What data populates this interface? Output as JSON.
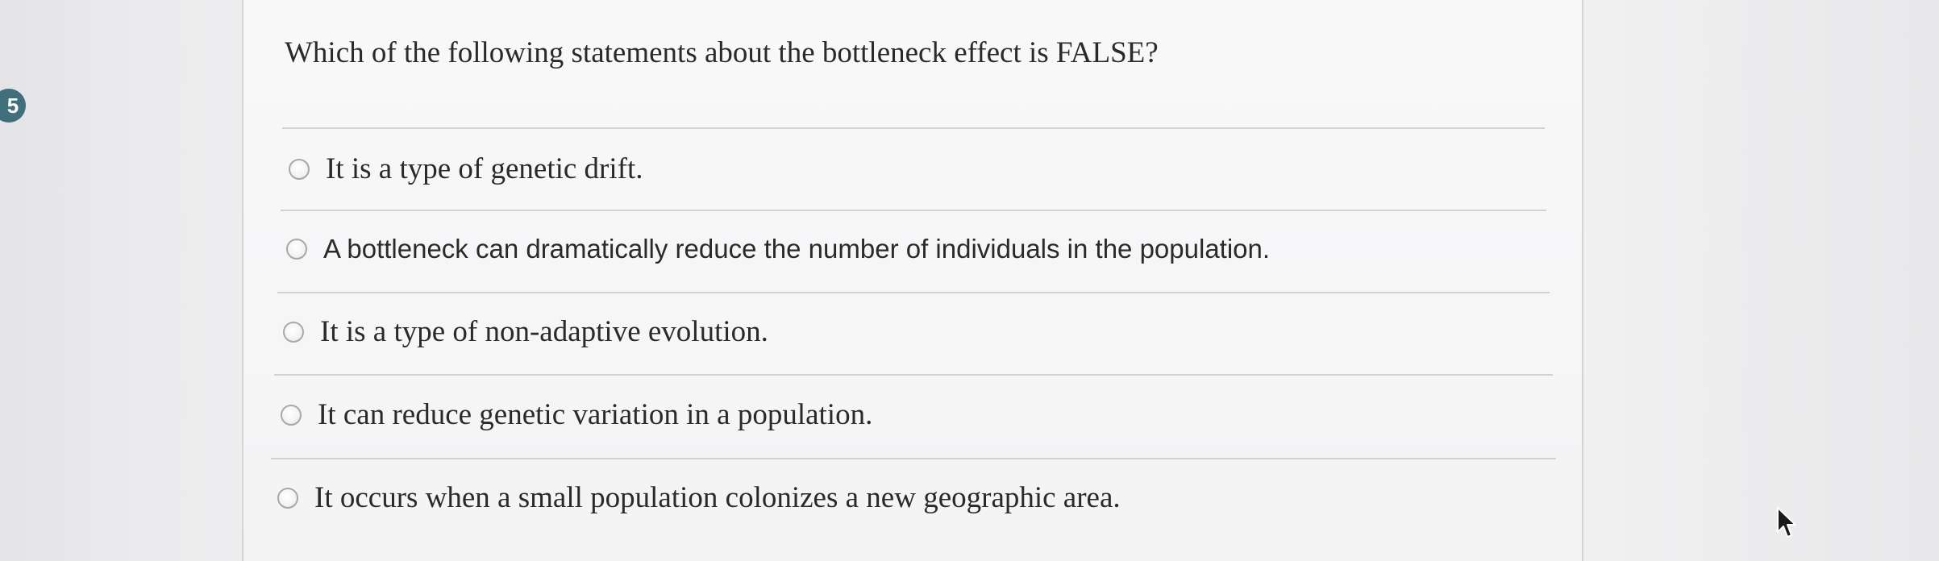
{
  "question": {
    "number": "5",
    "text": "Which of the following statements about the bottleneck effect is FALSE?"
  },
  "options": [
    {
      "label": "It is a type of genetic drift.",
      "selected": false
    },
    {
      "label": "A bottleneck can dramatically reduce the number of individuals in the population.",
      "selected": false
    },
    {
      "label": "It is a type of non-adaptive evolution.",
      "selected": false
    },
    {
      "label": "It can reduce genetic variation in a population.",
      "selected": false
    },
    {
      "label": "It occurs when a small population colonizes a new geographic area.",
      "selected": false
    }
  ],
  "colors": {
    "badge": "#3f6f7a",
    "text": "#2a2a2a",
    "divider": "#d2d2d4"
  },
  "icons": {
    "cursor": "mouse-pointer-icon",
    "radio": "radio-button-icon"
  }
}
